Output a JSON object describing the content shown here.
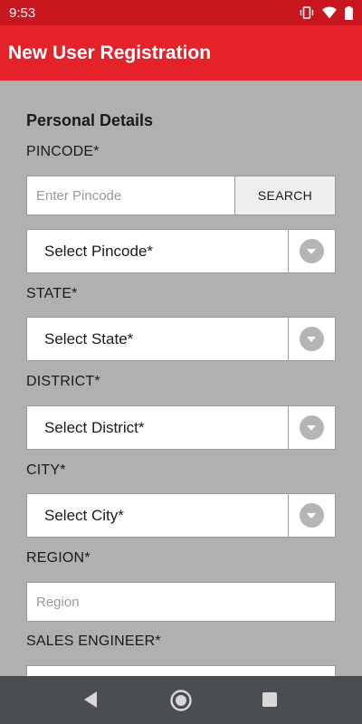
{
  "status_bar": {
    "time": "9:53"
  },
  "app_bar": {
    "title": "New User Registration"
  },
  "form": {
    "section_title": "Personal Details",
    "pincode_label": "PINCODE*",
    "pincode_placeholder": "Enter Pincode",
    "search_label": "SEARCH",
    "pincode_select": "Select Pincode*",
    "state_label": "STATE*",
    "state_select": "Select State*",
    "district_label": "DISTRICT*",
    "district_select": "Select District*",
    "city_label": "CITY*",
    "city_select": "Select City*",
    "region_label": "REGION*",
    "region_placeholder": "Region",
    "sales_engineer_label": "SALES ENGINEER*"
  },
  "colors": {
    "status_bar": "#c7161e",
    "app_bar": "#e3222a",
    "background": "#b0b0b0",
    "nav_bar": "#4a4e52"
  },
  "icons": [
    "vibrate-icon",
    "wifi-icon",
    "battery-icon",
    "dropdown-arrow-icon",
    "back-icon",
    "home-icon",
    "recents-icon"
  ]
}
